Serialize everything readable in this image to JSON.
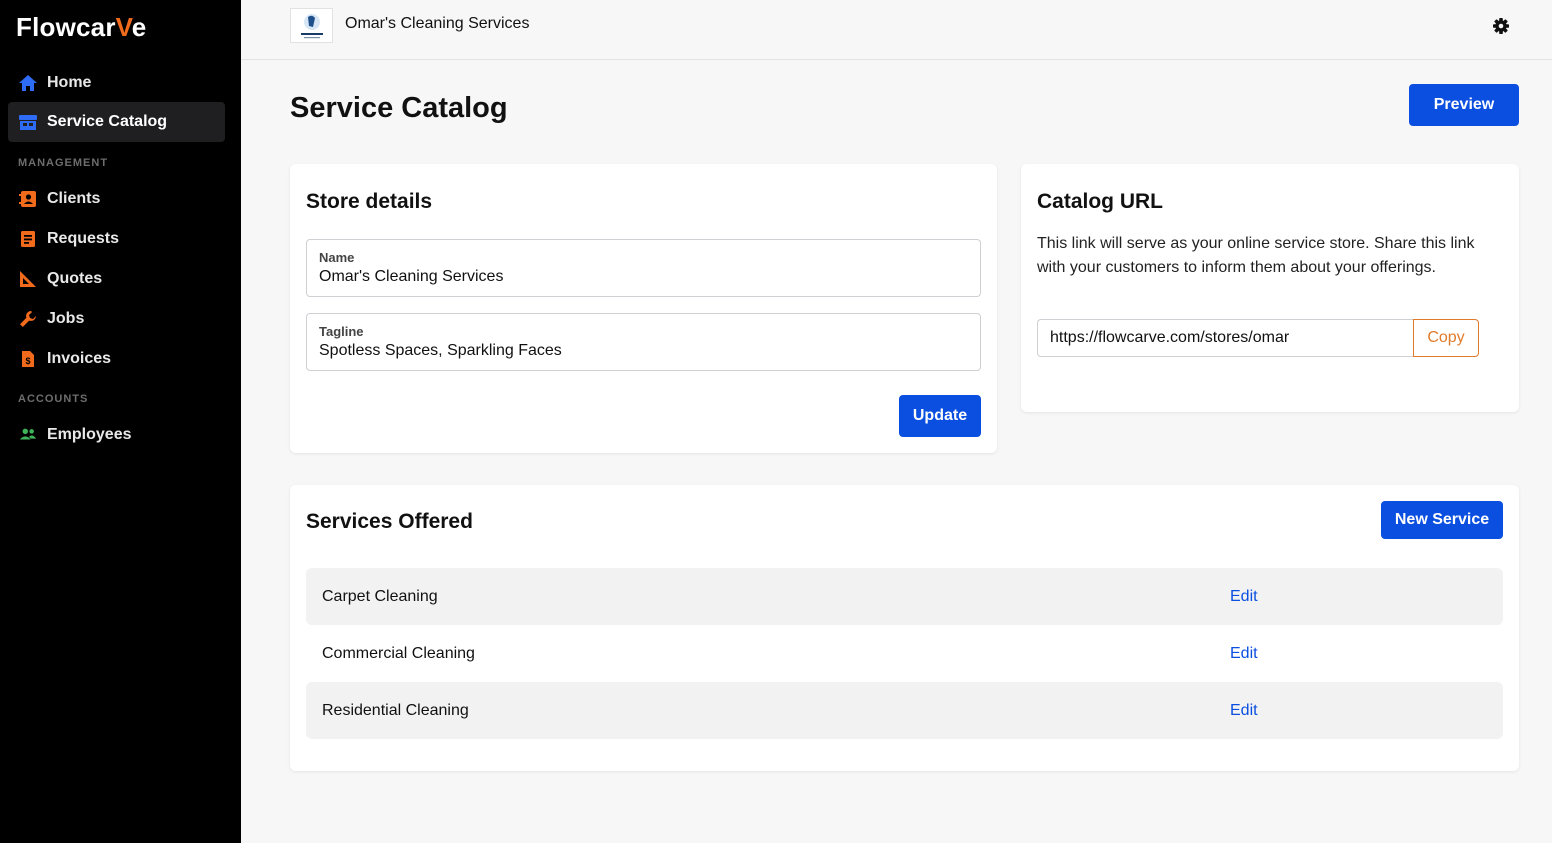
{
  "app": {
    "logo_prefix": "Flowcar",
    "logo_v": "V",
    "logo_suffix": "e"
  },
  "sidebar": {
    "items_top": [
      {
        "label": "Home",
        "icon": "home-icon",
        "active": false
      },
      {
        "label": "Service Catalog",
        "icon": "storefront-icon",
        "active": true
      }
    ],
    "management_label": "MANAGEMENT",
    "management_items": [
      {
        "label": "Clients",
        "icon": "contacts-icon"
      },
      {
        "label": "Requests",
        "icon": "receipt-icon"
      },
      {
        "label": "Quotes",
        "icon": "ruler-triangle-icon"
      },
      {
        "label": "Jobs",
        "icon": "wrench-icon"
      },
      {
        "label": "Invoices",
        "icon": "invoice-dollar-icon"
      }
    ],
    "accounts_label": "ACCOUNTS",
    "accounts_items": [
      {
        "label": "Employees",
        "icon": "people-icon"
      }
    ]
  },
  "header": {
    "business_name": "Omar's Cleaning Services",
    "settings_icon": "gear-icon"
  },
  "page": {
    "title": "Service Catalog",
    "preview_label": "Preview"
  },
  "store_details": {
    "heading": "Store details",
    "name_label": "Name",
    "name_value": "Omar's Cleaning Services",
    "tagline_label": "Tagline",
    "tagline_value": "Spotless Spaces, Sparkling Faces",
    "update_label": "Update"
  },
  "catalog_url": {
    "heading": "Catalog URL",
    "description": "This link will serve as your online service store. Share this link with your customers to inform them about your offerings.",
    "url": "https://flowcarve.com/stores/omar",
    "copy_label": "Copy"
  },
  "services": {
    "heading": "Services Offered",
    "new_label": "New Service",
    "edit_label": "Edit",
    "items": [
      "Carpet Cleaning",
      "Commercial Cleaning",
      "Residential Cleaning"
    ]
  },
  "colors": {
    "accent": "#0a4fe0",
    "brand_orange": "#f26a1b",
    "sidebar_bg": "#000000"
  }
}
